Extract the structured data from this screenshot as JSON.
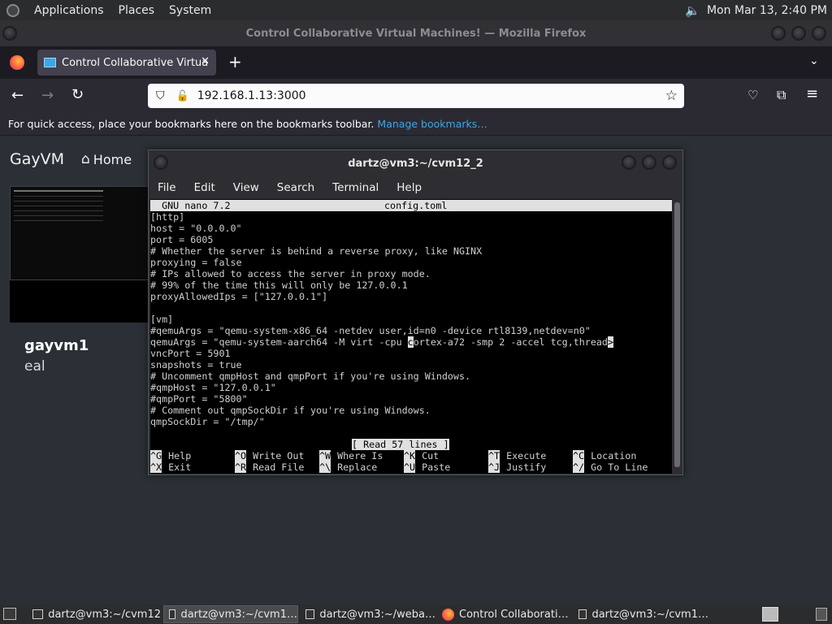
{
  "top_panel": {
    "menus": [
      "Applications",
      "Places",
      "System"
    ],
    "clock": "Mon Mar 13,  2:40 PM"
  },
  "firefox": {
    "window_title": "Control Collaborative Virtual Machines! — Mozilla Firefox",
    "tab_title": "Control Collaborative Virtua",
    "url": "192.168.1.13:3000",
    "bookmarks_text": "For quick access, place your bookmarks here on the bookmarks toolbar.",
    "bookmarks_link": "Manage bookmarks…"
  },
  "page": {
    "brand": "GayVM",
    "home": "Home",
    "vm_name": "gayvm1",
    "vm_sub": "eal"
  },
  "terminal": {
    "title": "dartz@vm3:~/cvm12_2",
    "menu": [
      "File",
      "Edit",
      "View",
      "Search",
      "Terminal",
      "Help"
    ],
    "nano_header_left": "  GNU nano 7.2",
    "nano_header_file": "config.toml",
    "lines": [
      "[http]",
      "host = \"0.0.0.0\"",
      "port = 6005",
      "# Whether the server is behind a reverse proxy, like NGINX",
      "proxying = false",
      "# IPs allowed to access the server in proxy mode.",
      "# 99% of the time this will only be 127.0.0.1",
      "proxyAllowedIps = [\"127.0.0.1\"]",
      "",
      "[vm]",
      "#qemuArgs = \"qemu-system-x86_64 -netdev user,id=n0 -device rtl8139,netdev=n0\"",
      "",
      "vncPort = 5901",
      "snapshots = true",
      "# Uncomment qmpHost and qmpPort if you're using Windows.",
      "#qmpHost = \"127.0.0.1\"",
      "#qmpPort = \"5800\"",
      "# Comment out qmpSockDir if you're using Windows.",
      "qmpSockDir = \"/tmp/\""
    ],
    "cursor_line_before": "qemuArgs = \"qemu-system-aarch64 -M virt -cpu ",
    "cursor_char": "c",
    "cursor_line_after": "ortex-a72 -smp 2 -accel tcg,thread",
    "truncation_marker": ">",
    "status": "[ Read 57 lines ]",
    "shortcuts": [
      {
        "key": "^G",
        "label": "Help"
      },
      {
        "key": "^O",
        "label": "Write Out"
      },
      {
        "key": "^W",
        "label": "Where Is"
      },
      {
        "key": "^K",
        "label": "Cut"
      },
      {
        "key": "^T",
        "label": "Execute"
      },
      {
        "key": "^C",
        "label": "Location"
      },
      {
        "key": "^X",
        "label": "Exit"
      },
      {
        "key": "^R",
        "label": "Read File"
      },
      {
        "key": "^\\",
        "label": "Replace"
      },
      {
        "key": "^U",
        "label": "Paste"
      },
      {
        "key": "^J",
        "label": "Justify"
      },
      {
        "key": "^/",
        "label": "Go To Line"
      }
    ]
  },
  "taskbar": {
    "tasks": [
      "dartz@vm3:~/cvm12",
      "dartz@vm3:~/cvm1…",
      "dartz@vm3:~/weba…",
      "Control Collaborati…",
      "dartz@vm3:~/cvm1…"
    ]
  },
  "colors": {
    "terminal_bg": "#000000",
    "nano_bar": "#e0e0e0",
    "link": "#3da6e8",
    "page_bg": "#2b3036"
  }
}
